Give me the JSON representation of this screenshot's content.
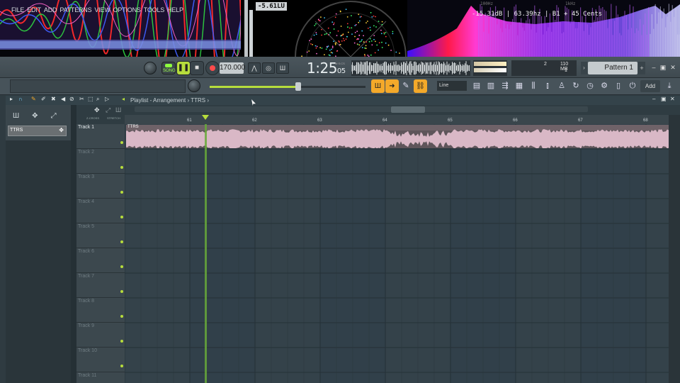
{
  "visualizer": {
    "lu_reading": "-5.61LU",
    "spectrum_readout": "-15.31dB | 63.39hz | B1 + 45 Cents",
    "freq_labels": [
      "100Hz",
      "1kHz"
    ]
  },
  "menu": {
    "items": [
      "FILE",
      "EDIT",
      "ADD",
      "PATTERNS",
      "VIEW",
      "OPTIONS",
      "TOOLS",
      "HELP"
    ]
  },
  "transport": {
    "mode_label": "SONG",
    "tempo": "170.000",
    "time_main": "1:25",
    "time_sub": "05",
    "time_unit": "M:S:CS",
    "cpu_value": "2",
    "memory": "110 MB",
    "polyphony": "1",
    "pattern": "Pattern 1"
  },
  "toolbar2": {
    "snap": "Line",
    "add_label": "Add"
  },
  "playlist": {
    "breadcrumb": "Playlist - Arrangement › TTRS ›",
    "ruler_labels": [
      "61",
      "62",
      "63",
      "64",
      "65",
      "66",
      "67",
      "68"
    ],
    "left_panel_item": "TTRS",
    "clip_name": "TTRS",
    "snap_small_1": "Z-CROSS",
    "snap_small_2": "STRETCH",
    "tracks": [
      {
        "name": "Track 1"
      },
      {
        "name": "Track 2"
      },
      {
        "name": "Track 3"
      },
      {
        "name": "Track 4"
      },
      {
        "name": "Track 5"
      },
      {
        "name": "Track 6"
      },
      {
        "name": "Track 7"
      },
      {
        "name": "Track 8"
      },
      {
        "name": "Track 9"
      },
      {
        "name": "Track 10"
      },
      {
        "name": "Track 11"
      }
    ]
  },
  "colors": {
    "accent": "#b7dd3c",
    "orange": "#f4a92a",
    "clip": "#d9b8c6"
  }
}
